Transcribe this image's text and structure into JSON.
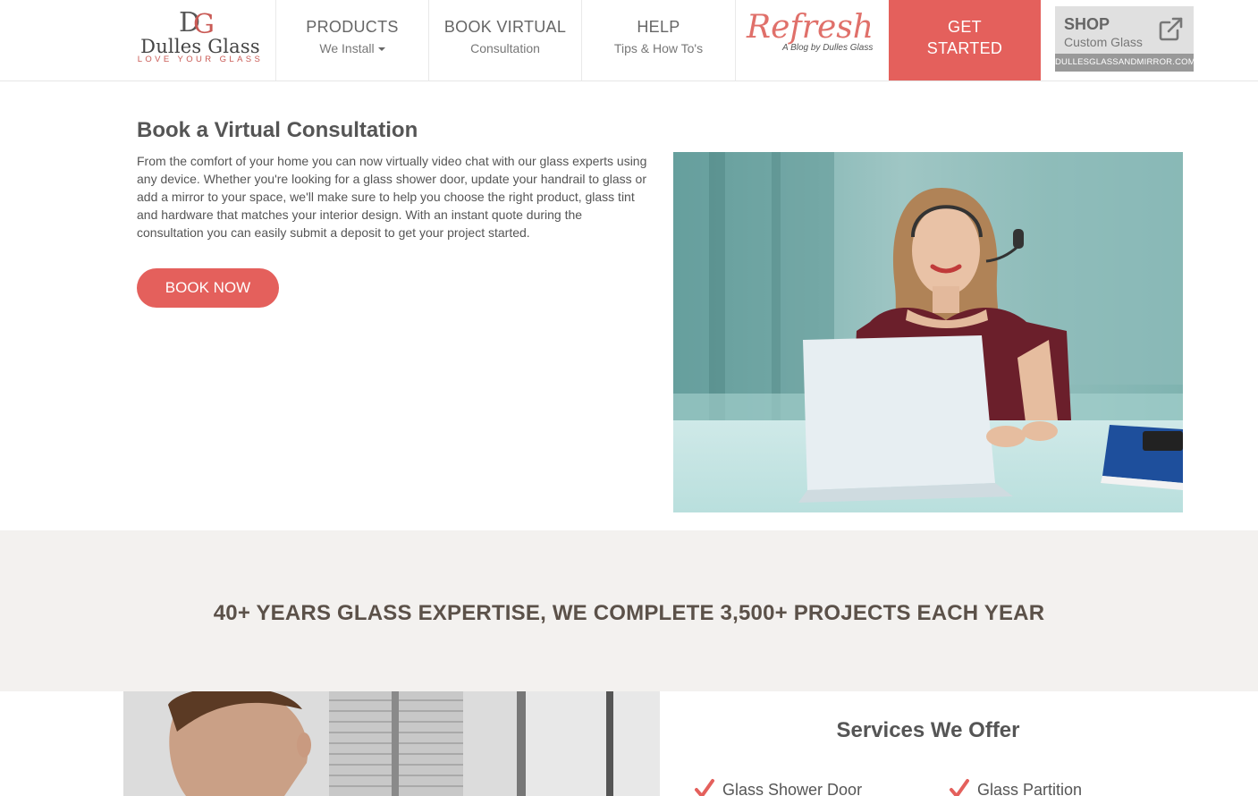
{
  "header": {
    "logo": {
      "monogram": "DG",
      "name": "Dulles Glass",
      "tagline": "LOVE YOUR GLASS"
    },
    "nav": [
      {
        "title": "PRODUCTS",
        "sub": "We Install",
        "has_caret": true
      },
      {
        "title": "BOOK VIRTUAL",
        "sub": "Consultation"
      },
      {
        "title": "HELP",
        "sub": "Tips & How To's"
      }
    ],
    "blog": {
      "script": "Refresh",
      "sub": "A Blog by Dulles Glass"
    },
    "get_started": {
      "line1": "GET",
      "line2": "STARTED"
    },
    "shop": {
      "title": "SHOP",
      "sub": "Custom Glass",
      "url": "DULLESGLASSANDMIRROR.COM",
      "icon": "external-link-icon"
    }
  },
  "consultation": {
    "title": "Book a Virtual Consultation",
    "body": "From the comfort of your home you can now virtually video chat with our glass experts using any device. Whether you're looking for a glass shower door, update your handrail to glass or add a mirror to your space, we'll make sure to help you choose the right product, glass tint and hardware that matches your interior design. With an instant quote during the consultation you can easily submit a deposit to get your project started.",
    "button": "BOOK NOW"
  },
  "band": {
    "text": "40+ YEARS GLASS EXPERTISE, WE COMPLETE 3,500+ PROJECTS EACH YEAR"
  },
  "services": {
    "title": "Services We Offer",
    "items": [
      "Glass Shower Door",
      "Glass Partition"
    ],
    "check_icon": "checkmark-icon"
  },
  "colors": {
    "accent": "#e4605c",
    "band_bg": "#f3f1ef",
    "shop_bg": "#e0e0e0",
    "shop_url_bg": "#999999",
    "text": "#555555"
  }
}
